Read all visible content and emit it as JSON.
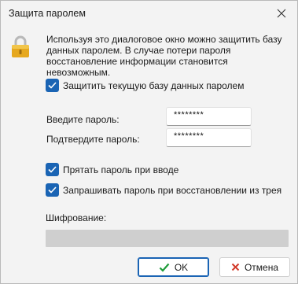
{
  "window": {
    "title": "Защита паролем"
  },
  "description": "Используя это диалоговое окно можно защитить базу данных паролем. В случае потери пароля восстановление информации становится невозможным.",
  "protect_checkbox": {
    "label": "Защитить текущую базу данных паролем",
    "checked": true
  },
  "fields": {
    "password_label": "Введите пароль:",
    "password_value": "********",
    "confirm_label": "Подтвердите пароль:",
    "confirm_value": "********"
  },
  "options": {
    "hide_label": "Прятать пароль при вводе",
    "hide_checked": true,
    "ask_tray_label": "Запрашивать пароль при восстановлении из трея",
    "ask_tray_checked": true
  },
  "encryption": {
    "label": "Шифрование:",
    "value": ""
  },
  "buttons": {
    "ok": "OK",
    "cancel": "Отмена"
  },
  "colors": {
    "accent": "#1a64b4",
    "ok_check": "#1e9c3a",
    "cancel_x": "#d23a2a",
    "lock": "#e0a21c"
  },
  "icons": {
    "close": "close-icon",
    "lock": "lock-icon",
    "ok": "checkmark-icon",
    "cancel": "x-icon"
  }
}
